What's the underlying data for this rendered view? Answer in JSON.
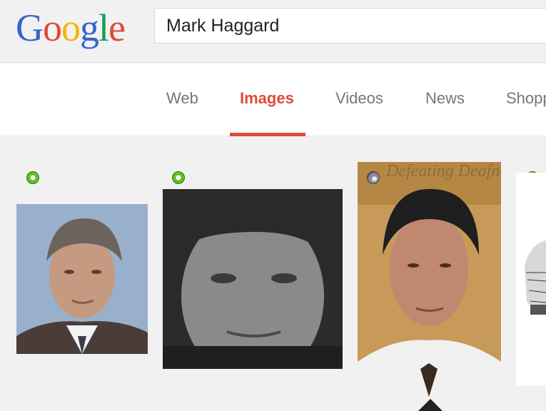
{
  "logo": {
    "letters": [
      "G",
      "o",
      "o",
      "g",
      "l",
      "e"
    ],
    "colors": [
      "#3366cc",
      "#dd4b39",
      "#f4b400",
      "#3366cc",
      "#109d58",
      "#dd4b39"
    ]
  },
  "search": {
    "query": "Mark Haggard"
  },
  "tabs": [
    {
      "label": "Web"
    },
    {
      "label": "Images",
      "active": true
    },
    {
      "label": "Videos"
    },
    {
      "label": "News"
    },
    {
      "label": "Shopp"
    }
  ],
  "colors": {
    "accent": "#dd4b39",
    "badge_green": "#5fbf1f"
  },
  "results": [
    {
      "name": "image-result-1",
      "badge": "green-circle-icon"
    },
    {
      "name": "image-result-2",
      "badge": "green-circle-icon"
    },
    {
      "name": "image-result-3",
      "badge": "gray-circle-icon",
      "watermark_text": "Defeating Deafne"
    },
    {
      "name": "image-result-4",
      "badge": "green-circle-icon"
    }
  ]
}
